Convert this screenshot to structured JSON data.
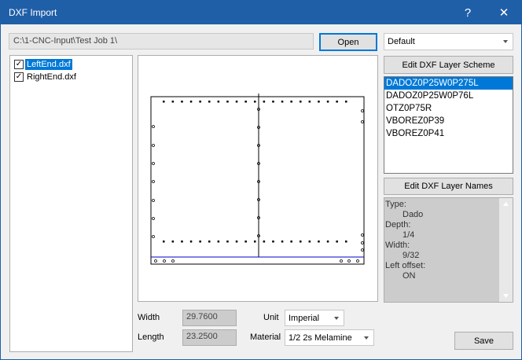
{
  "window": {
    "title": "DXF Import",
    "help_glyph": "?",
    "close_glyph": "✕"
  },
  "top": {
    "path": "C:\\1-CNC-Input\\Test Job 1\\",
    "open_label": "Open",
    "scheme_value": "Default"
  },
  "files": [
    {
      "name": "LeftEnd.dxf",
      "checked": true,
      "selected": true
    },
    {
      "name": "RightEnd.dxf",
      "checked": true,
      "selected": false
    }
  ],
  "check_glyph": "✓",
  "right": {
    "edit_scheme_label": "Edit DXF Layer Scheme",
    "layers": [
      "DADOZ0P25W0P275L",
      "DADOZ0P25W0P76L",
      "OTZ0P75R",
      "VBOREZ0P39",
      "VBOREZ0P41"
    ],
    "edit_names_label": "Edit DXF Layer Names",
    "info": {
      "type_label": "Type:",
      "type_value": "Dado",
      "depth_label": "Depth:",
      "depth_value": "1/4",
      "width_label": "Width:",
      "width_value": "9/32",
      "offset_label": "Left offset:",
      "offset_value": "ON"
    }
  },
  "bottom": {
    "width_label": "Width",
    "width_value": "29.7600",
    "length_label": "Length",
    "length_value": "23.2500",
    "unit_label": "Unit",
    "unit_value": "Imperial",
    "material_label": "Material",
    "material_value": "1/2 2s Melamine",
    "save_label": "Save"
  },
  "colors": {
    "title_bar": "#1f5fa8",
    "selection": "#0078d7",
    "drawing_line": "#0000cc"
  }
}
